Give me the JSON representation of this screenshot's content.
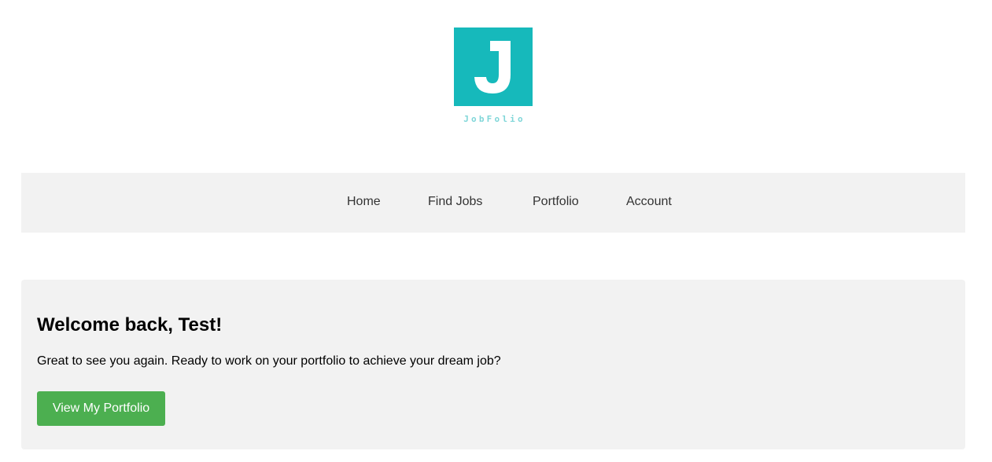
{
  "logo": {
    "letter": "J",
    "wordmark": "JobFolio",
    "color": "#16b9bb",
    "wordmark_color": "#7fd6d8"
  },
  "nav": {
    "items": [
      {
        "label": "Home"
      },
      {
        "label": "Find Jobs"
      },
      {
        "label": "Portfolio"
      },
      {
        "label": "Account"
      }
    ]
  },
  "welcome": {
    "title": "Welcome back, Test!",
    "message": "Great to see you again. Ready to work on your portfolio to achieve your dream job?",
    "button_label": "View My Portfolio",
    "button_color": "#4caf50"
  }
}
